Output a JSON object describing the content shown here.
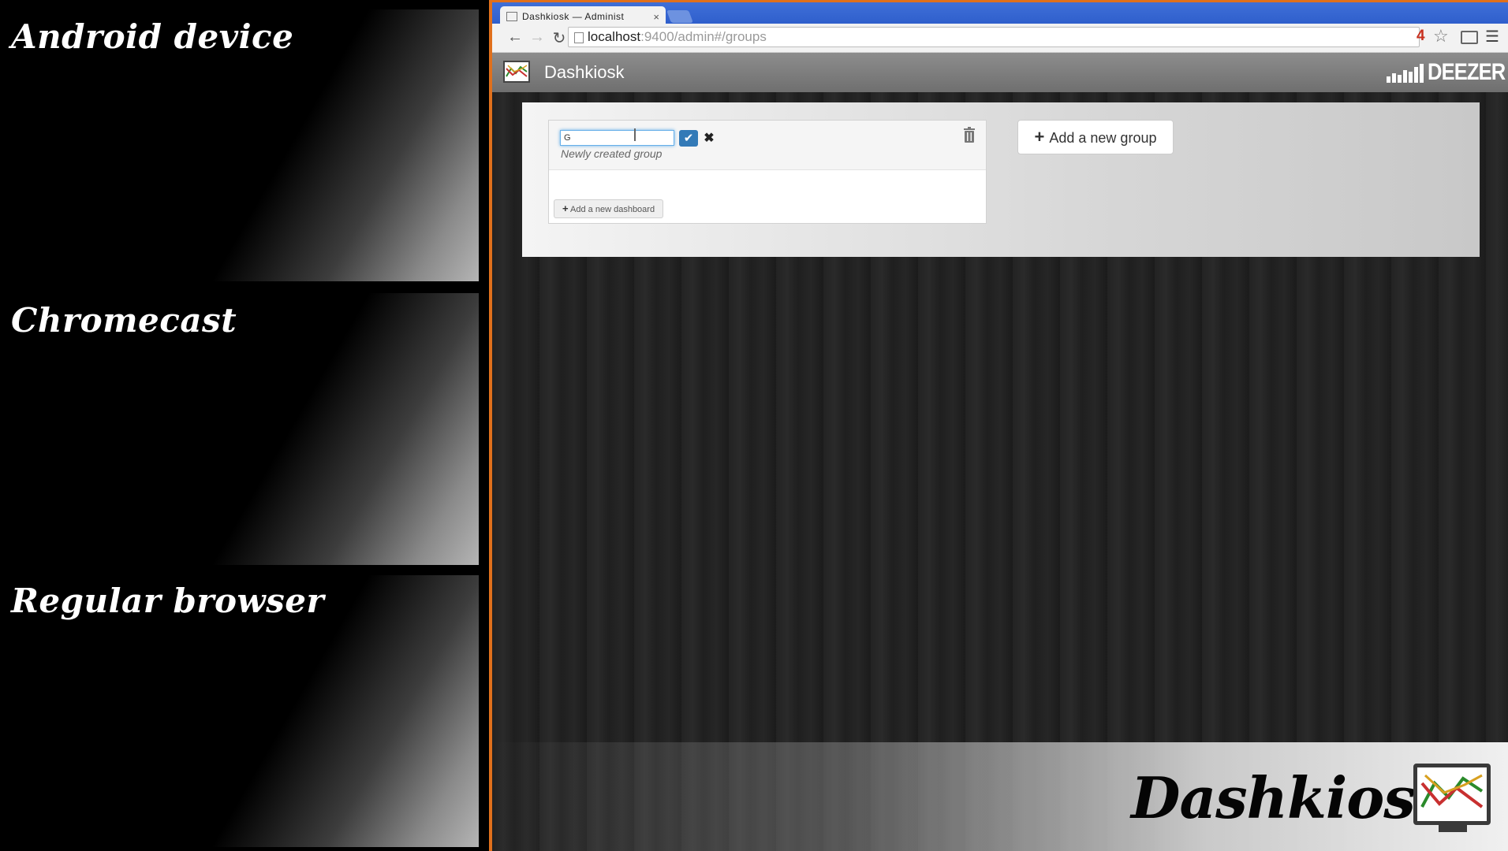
{
  "previews": [
    {
      "label": "Android device"
    },
    {
      "label": "Chromecast"
    },
    {
      "label": "Regular browser"
    }
  ],
  "browser": {
    "tab_title": "Dashkiosk — Administ",
    "tab_close": "×",
    "url_host": "localhost",
    "url_path": ":9400/admin#/groups",
    "extension_badge": "4"
  },
  "app": {
    "title": "Dashkiosk",
    "brand": "DEEZER"
  },
  "group": {
    "name_value": "G",
    "description": "Newly created group",
    "add_dashboard_label": "Add a new dashboard"
  },
  "actions": {
    "add_group_label": "Add a new group"
  },
  "branding": {
    "title": "Dashkiosk"
  },
  "colors": {
    "accent_orange": "#e0701c",
    "tab_strip_blue": "#2f5fcc",
    "confirm_blue": "#337ab7"
  }
}
